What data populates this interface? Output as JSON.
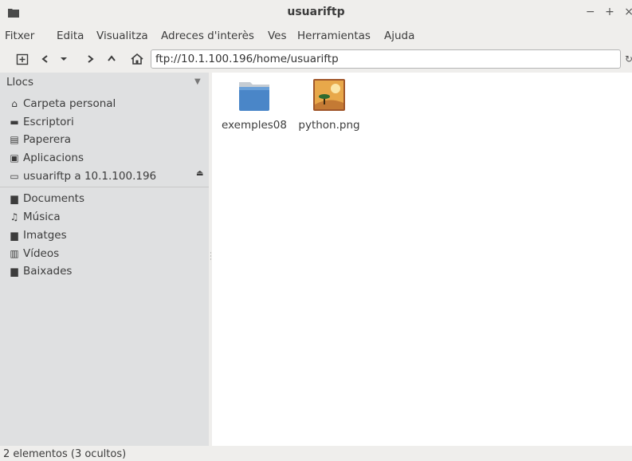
{
  "window": {
    "title": "usuariftp",
    "controls": "− + ×"
  },
  "menu": [
    "Fitxer",
    "Edita",
    "Visualitza",
    "Adreces d'interès",
    "Ves",
    "Herramientas",
    "Ajuda"
  ],
  "toolbar": {
    "location": "ftp://10.1.100.196/home/usuariftp"
  },
  "sidebar": {
    "header": "Llocs",
    "places": [
      {
        "label": "Carpeta personal",
        "icon": "home-icon"
      },
      {
        "label": "Escriptori",
        "icon": "desktop-icon"
      },
      {
        "label": "Paperera",
        "icon": "trash-icon"
      },
      {
        "label": "Aplicacions",
        "icon": "applications-icon"
      },
      {
        "label": "usuariftp a 10.1.100.196",
        "icon": "network-drive-icon"
      }
    ],
    "bookmarks": [
      {
        "label": "Documents",
        "icon": "folder-icon"
      },
      {
        "label": "Música",
        "icon": "music-icon"
      },
      {
        "label": "Imatges",
        "icon": "folder-icon"
      },
      {
        "label": "Vídeos",
        "icon": "video-icon"
      },
      {
        "label": "Baixades",
        "icon": "folder-icon"
      }
    ]
  },
  "files": [
    {
      "name": "exemples08",
      "type": "folder-icon"
    },
    {
      "name": "python.png",
      "type": "image-icon"
    }
  ],
  "status": "2 elementos (3 ocultos)",
  "colors": {
    "sidebar_bg": "#dfe0e1",
    "content_bg": "#ffffff",
    "window_bg": "#efeeec",
    "folder": "#4a86c8"
  }
}
